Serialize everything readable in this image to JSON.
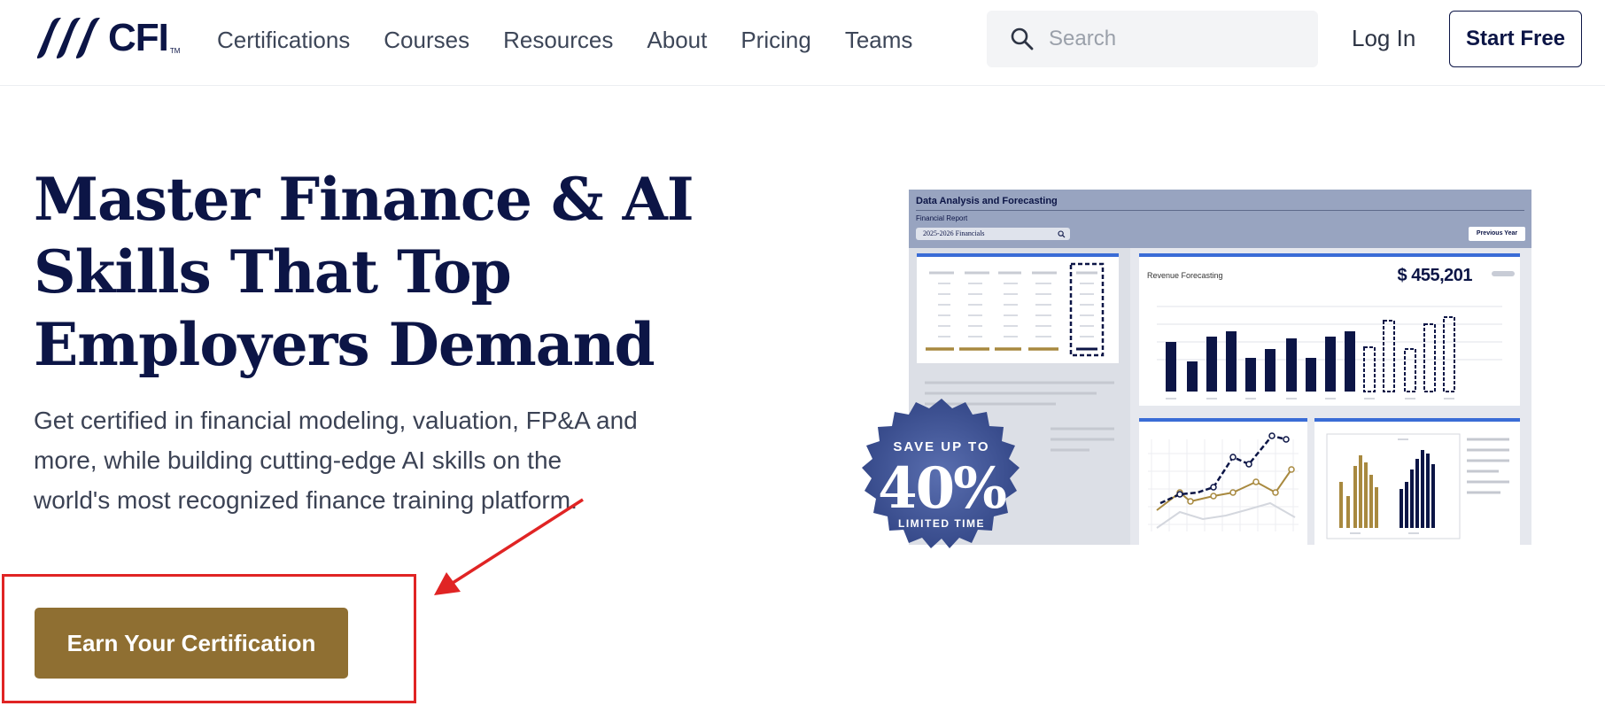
{
  "brand": {
    "logo_text": "CFI",
    "trademark": "TM"
  },
  "nav": {
    "items": [
      "Certifications",
      "Courses",
      "Resources",
      "About",
      "Pricing",
      "Teams"
    ]
  },
  "search": {
    "placeholder": "Search"
  },
  "header_actions": {
    "login": "Log In",
    "start": "Start Free"
  },
  "hero": {
    "headline_lines": [
      "Master Finance & AI",
      "Skills That Top",
      "Employers Demand"
    ],
    "subtext": "Get certified in financial modeling, valuation, FP&A and more, while building cutting-edge AI skills on the world's most recognized finance training platform.",
    "cta": "Earn Your Certification"
  },
  "dashboard": {
    "title": "Data Analysis and Forecasting",
    "subtitle": "Financial Report",
    "select": "2025-2026 Financials",
    "previous_button": "Previous Year",
    "revenue_label": "Revenue Forecasting",
    "revenue_value": "$ 455,201"
  },
  "badge": {
    "top": "SAVE UP TO",
    "big": "40%",
    "bottom": "LIMITED TIME"
  },
  "colors": {
    "navy": "#0c1546",
    "gold": "#8f6f32",
    "accent_blue": "#3a6cd6",
    "annotation_red": "#e02424",
    "badge_blue": "#3b4f8e"
  }
}
